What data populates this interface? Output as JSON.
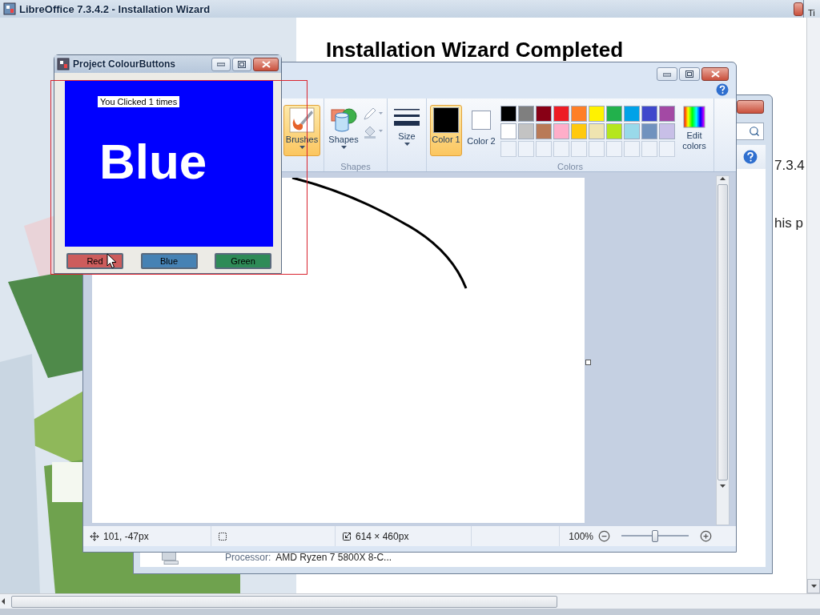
{
  "installer": {
    "title": "LibreOffice 7.3.4.2 - Installation Wizard",
    "heading": "Installation Wizard Completed",
    "lines": [
      "7.3.4",
      "his p"
    ]
  },
  "back_window": {
    "title": "Ti"
  },
  "system_window": {
    "processor_label": "Processor:",
    "processor_value": "AMD Ryzen 7 5800X 8-C..."
  },
  "paint": {
    "tools": [
      {
        "kind": "brushes",
        "label": "Brushes",
        "selected": true
      },
      {
        "kind": "shapes",
        "label": "Shapes",
        "selected": false
      },
      {
        "kind": "size",
        "label": "Size",
        "selected": false
      }
    ],
    "shapes_group_label": "Shapes",
    "colors_group_label": "Colors",
    "color_slots": [
      {
        "label": "Color 1",
        "color": "#000000",
        "selected": true
      },
      {
        "label": "Color 2",
        "color": "#ffffff",
        "selected": false
      }
    ],
    "palette": [
      {
        "color": "#000000"
      },
      {
        "color": "#7f7f7f"
      },
      {
        "color": "#880015"
      },
      {
        "color": "#ed1c24"
      },
      {
        "color": "#ff7f27"
      },
      {
        "color": "#fff200"
      },
      {
        "color": "#22b14c"
      },
      {
        "color": "#00a2e8"
      },
      {
        "color": "#3f48cc"
      },
      {
        "color": "#a349a4"
      },
      {
        "color": "#ffffff"
      },
      {
        "color": "#c3c3c3"
      },
      {
        "color": "#b97a57"
      },
      {
        "color": "#ffaec9"
      },
      {
        "color": "#ffc90e"
      },
      {
        "color": "#efe4b0"
      },
      {
        "color": "#b5e61d"
      },
      {
        "color": "#99d9ea"
      },
      {
        "color": "#7092be"
      },
      {
        "color": "#c8bfe7"
      }
    ],
    "edit_colors": "Edit colors",
    "status": {
      "position": "101, -47px",
      "canvas_size": "614 × 460px",
      "zoom": "100%"
    },
    "zoom_slider": {
      "level": 0.5
    }
  },
  "colour_app": {
    "title": "Project ColourButtons",
    "counter": "You Clicked 1 times",
    "colour_name": "Blue",
    "buttons": [
      {
        "label": "Red",
        "color": "#cd5c5c"
      },
      {
        "label": "Blue",
        "color": "#4682b4"
      },
      {
        "label": "Green",
        "color": "#2e8b57"
      }
    ]
  }
}
